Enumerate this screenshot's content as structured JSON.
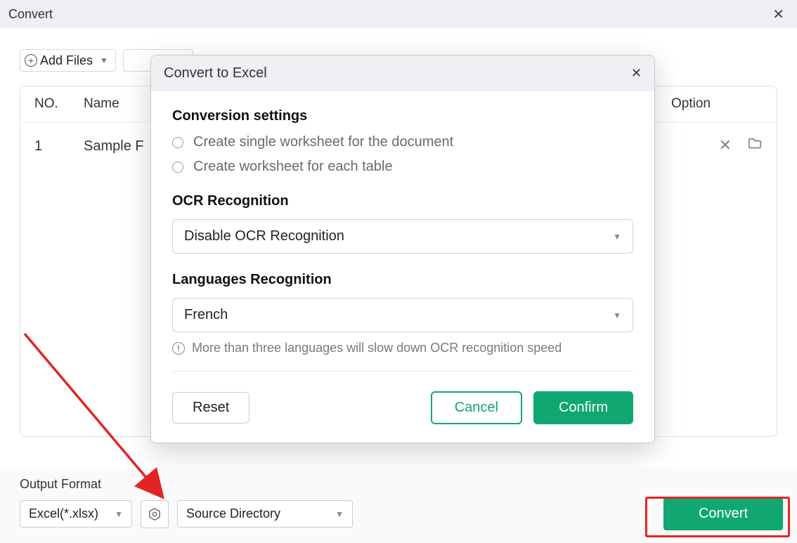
{
  "header": {
    "title": "Convert"
  },
  "toolbar": {
    "add_files_label": "Add Files"
  },
  "table": {
    "headers": {
      "no": "NO.",
      "name": "Name",
      "option": "Option"
    },
    "rows": [
      {
        "no": "1",
        "name": "Sample F"
      }
    ]
  },
  "bottom": {
    "output_format_label": "Output Format",
    "output_format_value": "Excel(*.xlsx)",
    "output_dir_value": "Source Directory",
    "convert_label": "Convert"
  },
  "modal": {
    "title": "Convert to Excel",
    "section_conversion": "Conversion settings",
    "radio_single": "Create single worksheet for the document",
    "radio_each": "Create worksheet for each table",
    "section_ocr": "OCR Recognition",
    "ocr_value": "Disable OCR Recognition",
    "section_lang": "Languages Recognition",
    "lang_value": "French",
    "hint": "More than three languages will slow down OCR recognition speed",
    "reset": "Reset",
    "cancel": "Cancel",
    "confirm": "Confirm"
  }
}
